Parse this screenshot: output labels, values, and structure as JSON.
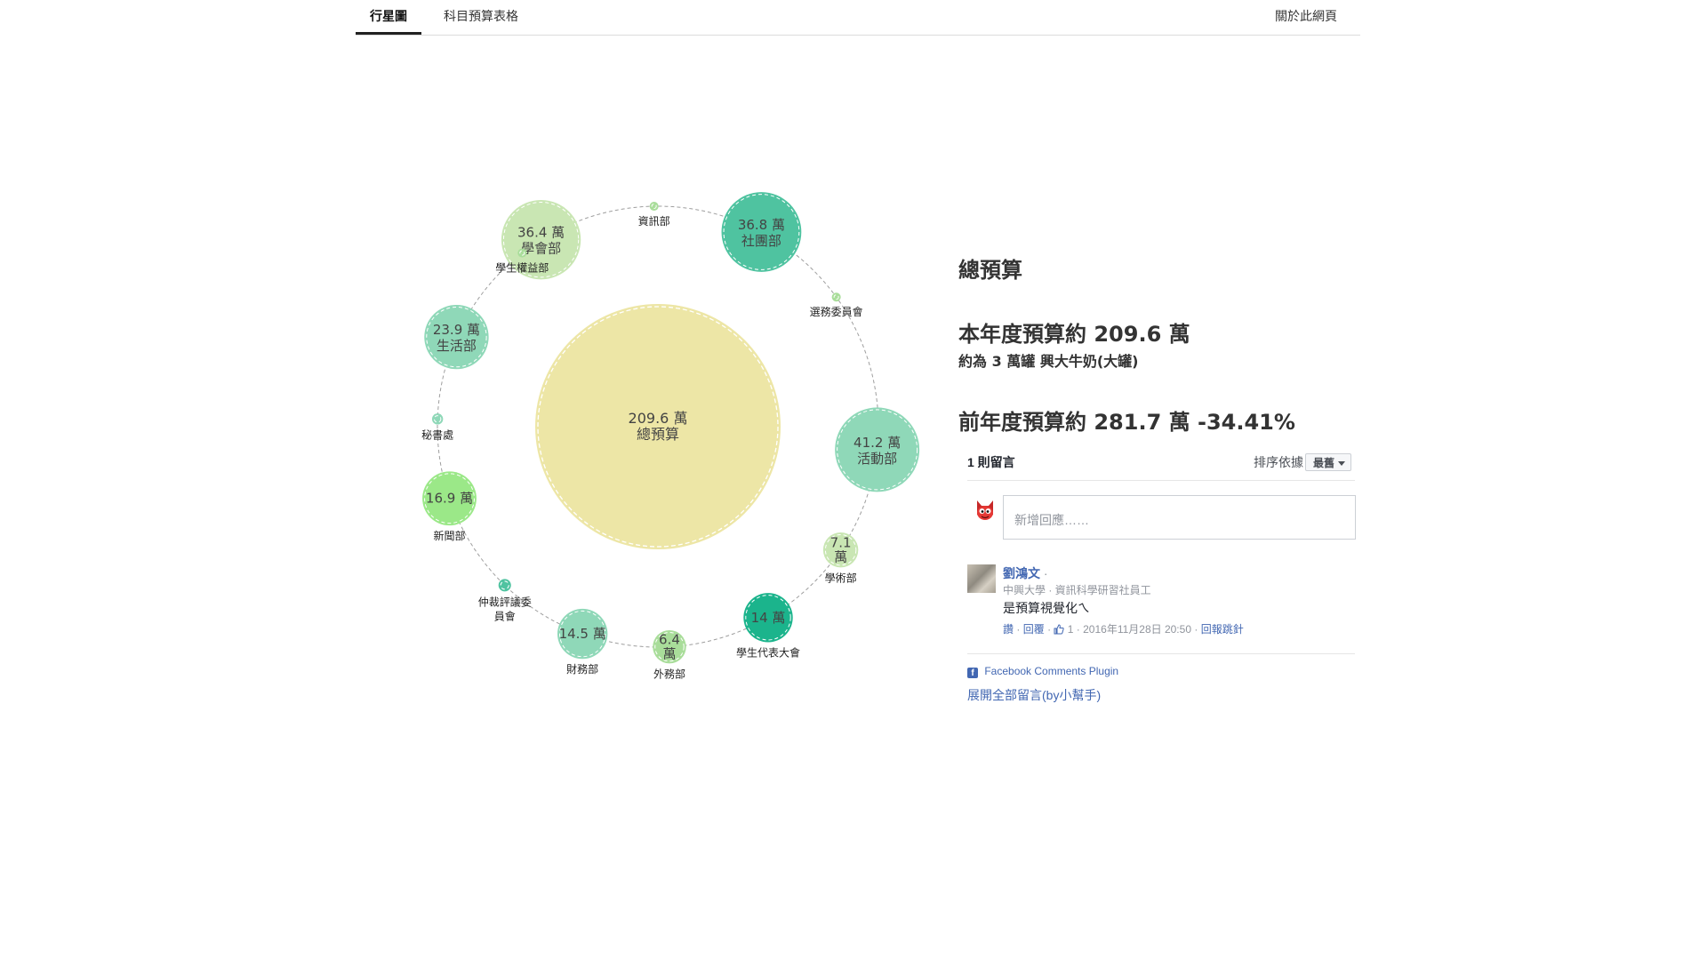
{
  "nav": {
    "tabs": [
      {
        "label": "行星圖",
        "active": true
      },
      {
        "label": "科目預算表格",
        "active": false
      }
    ],
    "about_label": "關於此網頁"
  },
  "info": {
    "title": "總預算",
    "current_budget": "本年度預算約 209.6 萬",
    "milk_equiv": "約為 3 萬罐 興大牛奶(大罐)",
    "previous_budget": "前年度預算約 281.7 萬 -34.41%"
  },
  "comments": {
    "count_label": "1 則留言",
    "sort_label": "排序依據",
    "sort_value": "最舊",
    "input_placeholder": "新增回應……",
    "items": [
      {
        "author": "劉鴻文",
        "author_suffix": "·",
        "meta": "中興大學 · 資訊科學研習社員工",
        "text": "是預算視覺化ㄟ",
        "like_label": "讚",
        "reply_label": "回覆",
        "like_count": "1",
        "timestamp": "2016年11月28日 20:50",
        "follow_label": "回報跳針"
      }
    ],
    "plugin_label": "Facebook Comments Plugin",
    "expand_label": "展開全部留言(by小幫手)"
  },
  "colors": {
    "center": "#ede6a6",
    "light_green": "#c9e6b3",
    "teal": "#4fc3a0",
    "mint": "#8fd8b8",
    "dark_teal": "#1bb48c",
    "bright_green": "#9be888",
    "link_blue": "#4267b2"
  },
  "chart_data": {
    "type": "bubble",
    "unit": "萬",
    "center": {
      "name": "總預算",
      "value": 209.6,
      "label": "209.6 萬",
      "name_label": "總預算",
      "color": "#ede6a6"
    },
    "nodes": [
      {
        "name": "學會部",
        "value": 36.4,
        "label": "36.4 萬",
        "inner_name": "學會部",
        "show_value": true,
        "color": "#c9e6b3"
      },
      {
        "name": "資訊部",
        "value": 0.2,
        "label": "",
        "outer_name": "資訊部",
        "show_value": false,
        "color": "#a9dd9a"
      },
      {
        "name": "社團部",
        "value": 36.8,
        "label": "36.8 萬",
        "inner_name": "社團部",
        "show_value": true,
        "color": "#4fc3a0"
      },
      {
        "name": "選務委員會",
        "value": 0.1,
        "label": "",
        "outer_name": "選務委員會",
        "show_value": false,
        "color": "#a9dd9a"
      },
      {
        "name": "活動部",
        "value": 41.2,
        "label": "41.2 萬",
        "inner_name": "活動部",
        "show_value": true,
        "color": "#8fd8b8"
      },
      {
        "name": "學術部",
        "value": 7.1,
        "label": "7.1 萬",
        "outer_name": "學術部",
        "show_value": true,
        "color": "#c9e6b3"
      },
      {
        "name": "學生代表大會",
        "value": 14,
        "label": "14 萬",
        "outer_name": "學生代表大會",
        "show_value": true,
        "color": "#1bb48c"
      },
      {
        "name": "外務部",
        "value": 6.4,
        "label": "6.4 萬",
        "outer_name": "外務部",
        "show_value": true,
        "color": "#a9dd9a"
      },
      {
        "name": "財務部",
        "value": 14.5,
        "label": "14.5 萬",
        "outer_name": "財務部",
        "show_value": true,
        "color": "#8fd8b8"
      },
      {
        "name": "仲裁評議委員會",
        "value": 0.9,
        "label": "",
        "outer_name": "仲裁評議委\n員會",
        "show_value": false,
        "color": "#4fc3a0"
      },
      {
        "name": "新聞部",
        "value": 16.9,
        "label": "16.9 萬",
        "outer_name": "新聞部",
        "show_value": true,
        "color": "#9be888"
      },
      {
        "name": "秘書處",
        "value": 0.7,
        "label": "",
        "outer_name": "秘書處",
        "show_value": false,
        "color": "#8fd8b8"
      },
      {
        "name": "生活部",
        "value": 23.9,
        "label": "23.9 萬",
        "inner_name": "生活部",
        "show_value": true,
        "color": "#8fd8b8"
      },
      {
        "name": "學生權益部",
        "value": 0.2,
        "label": "",
        "outer_name": "學生權益部",
        "show_value": false,
        "color": "#a9dd9a"
      }
    ]
  }
}
